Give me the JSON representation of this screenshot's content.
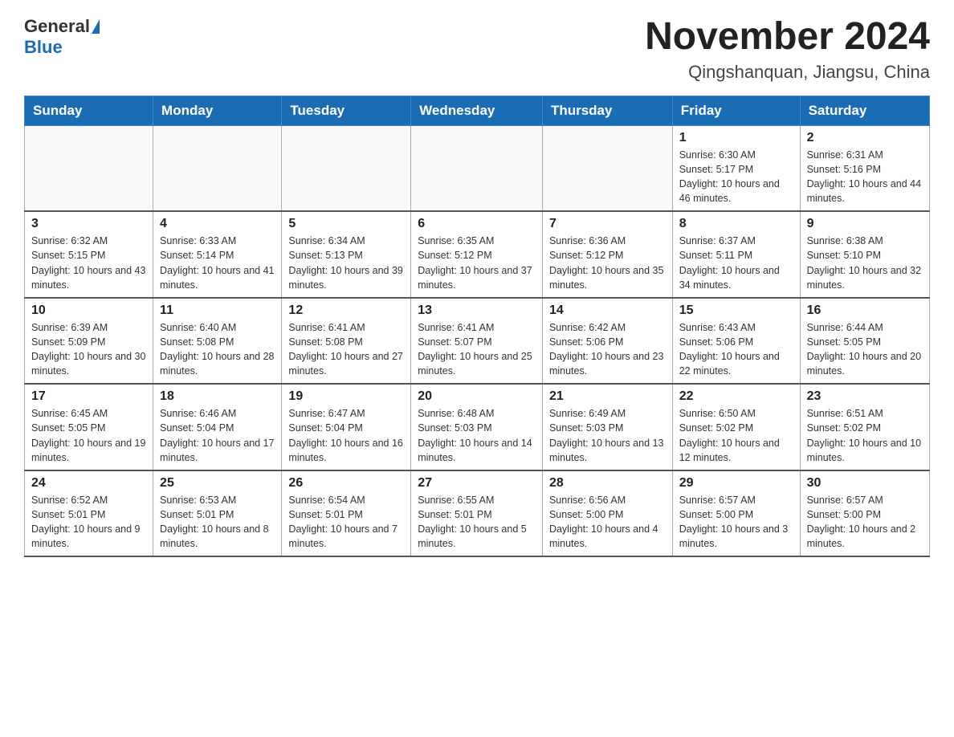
{
  "header": {
    "logo_general": "General",
    "logo_blue": "Blue",
    "title": "November 2024",
    "subtitle": "Qingshanquan, Jiangsu, China"
  },
  "days_of_week": [
    "Sunday",
    "Monday",
    "Tuesday",
    "Wednesday",
    "Thursday",
    "Friday",
    "Saturday"
  ],
  "weeks": [
    [
      {
        "day": "",
        "sunrise": "",
        "sunset": "",
        "daylight": "",
        "empty": true
      },
      {
        "day": "",
        "sunrise": "",
        "sunset": "",
        "daylight": "",
        "empty": true
      },
      {
        "day": "",
        "sunrise": "",
        "sunset": "",
        "daylight": "",
        "empty": true
      },
      {
        "day": "",
        "sunrise": "",
        "sunset": "",
        "daylight": "",
        "empty": true
      },
      {
        "day": "",
        "sunrise": "",
        "sunset": "",
        "daylight": "",
        "empty": true
      },
      {
        "day": "1",
        "sunrise": "Sunrise: 6:30 AM",
        "sunset": "Sunset: 5:17 PM",
        "daylight": "Daylight: 10 hours and 46 minutes.",
        "empty": false
      },
      {
        "day": "2",
        "sunrise": "Sunrise: 6:31 AM",
        "sunset": "Sunset: 5:16 PM",
        "daylight": "Daylight: 10 hours and 44 minutes.",
        "empty": false
      }
    ],
    [
      {
        "day": "3",
        "sunrise": "Sunrise: 6:32 AM",
        "sunset": "Sunset: 5:15 PM",
        "daylight": "Daylight: 10 hours and 43 minutes.",
        "empty": false
      },
      {
        "day": "4",
        "sunrise": "Sunrise: 6:33 AM",
        "sunset": "Sunset: 5:14 PM",
        "daylight": "Daylight: 10 hours and 41 minutes.",
        "empty": false
      },
      {
        "day": "5",
        "sunrise": "Sunrise: 6:34 AM",
        "sunset": "Sunset: 5:13 PM",
        "daylight": "Daylight: 10 hours and 39 minutes.",
        "empty": false
      },
      {
        "day": "6",
        "sunrise": "Sunrise: 6:35 AM",
        "sunset": "Sunset: 5:12 PM",
        "daylight": "Daylight: 10 hours and 37 minutes.",
        "empty": false
      },
      {
        "day": "7",
        "sunrise": "Sunrise: 6:36 AM",
        "sunset": "Sunset: 5:12 PM",
        "daylight": "Daylight: 10 hours and 35 minutes.",
        "empty": false
      },
      {
        "day": "8",
        "sunrise": "Sunrise: 6:37 AM",
        "sunset": "Sunset: 5:11 PM",
        "daylight": "Daylight: 10 hours and 34 minutes.",
        "empty": false
      },
      {
        "day": "9",
        "sunrise": "Sunrise: 6:38 AM",
        "sunset": "Sunset: 5:10 PM",
        "daylight": "Daylight: 10 hours and 32 minutes.",
        "empty": false
      }
    ],
    [
      {
        "day": "10",
        "sunrise": "Sunrise: 6:39 AM",
        "sunset": "Sunset: 5:09 PM",
        "daylight": "Daylight: 10 hours and 30 minutes.",
        "empty": false
      },
      {
        "day": "11",
        "sunrise": "Sunrise: 6:40 AM",
        "sunset": "Sunset: 5:08 PM",
        "daylight": "Daylight: 10 hours and 28 minutes.",
        "empty": false
      },
      {
        "day": "12",
        "sunrise": "Sunrise: 6:41 AM",
        "sunset": "Sunset: 5:08 PM",
        "daylight": "Daylight: 10 hours and 27 minutes.",
        "empty": false
      },
      {
        "day": "13",
        "sunrise": "Sunrise: 6:41 AM",
        "sunset": "Sunset: 5:07 PM",
        "daylight": "Daylight: 10 hours and 25 minutes.",
        "empty": false
      },
      {
        "day": "14",
        "sunrise": "Sunrise: 6:42 AM",
        "sunset": "Sunset: 5:06 PM",
        "daylight": "Daylight: 10 hours and 23 minutes.",
        "empty": false
      },
      {
        "day": "15",
        "sunrise": "Sunrise: 6:43 AM",
        "sunset": "Sunset: 5:06 PM",
        "daylight": "Daylight: 10 hours and 22 minutes.",
        "empty": false
      },
      {
        "day": "16",
        "sunrise": "Sunrise: 6:44 AM",
        "sunset": "Sunset: 5:05 PM",
        "daylight": "Daylight: 10 hours and 20 minutes.",
        "empty": false
      }
    ],
    [
      {
        "day": "17",
        "sunrise": "Sunrise: 6:45 AM",
        "sunset": "Sunset: 5:05 PM",
        "daylight": "Daylight: 10 hours and 19 minutes.",
        "empty": false
      },
      {
        "day": "18",
        "sunrise": "Sunrise: 6:46 AM",
        "sunset": "Sunset: 5:04 PM",
        "daylight": "Daylight: 10 hours and 17 minutes.",
        "empty": false
      },
      {
        "day": "19",
        "sunrise": "Sunrise: 6:47 AM",
        "sunset": "Sunset: 5:04 PM",
        "daylight": "Daylight: 10 hours and 16 minutes.",
        "empty": false
      },
      {
        "day": "20",
        "sunrise": "Sunrise: 6:48 AM",
        "sunset": "Sunset: 5:03 PM",
        "daylight": "Daylight: 10 hours and 14 minutes.",
        "empty": false
      },
      {
        "day": "21",
        "sunrise": "Sunrise: 6:49 AM",
        "sunset": "Sunset: 5:03 PM",
        "daylight": "Daylight: 10 hours and 13 minutes.",
        "empty": false
      },
      {
        "day": "22",
        "sunrise": "Sunrise: 6:50 AM",
        "sunset": "Sunset: 5:02 PM",
        "daylight": "Daylight: 10 hours and 12 minutes.",
        "empty": false
      },
      {
        "day": "23",
        "sunrise": "Sunrise: 6:51 AM",
        "sunset": "Sunset: 5:02 PM",
        "daylight": "Daylight: 10 hours and 10 minutes.",
        "empty": false
      }
    ],
    [
      {
        "day": "24",
        "sunrise": "Sunrise: 6:52 AM",
        "sunset": "Sunset: 5:01 PM",
        "daylight": "Daylight: 10 hours and 9 minutes.",
        "empty": false
      },
      {
        "day": "25",
        "sunrise": "Sunrise: 6:53 AM",
        "sunset": "Sunset: 5:01 PM",
        "daylight": "Daylight: 10 hours and 8 minutes.",
        "empty": false
      },
      {
        "day": "26",
        "sunrise": "Sunrise: 6:54 AM",
        "sunset": "Sunset: 5:01 PM",
        "daylight": "Daylight: 10 hours and 7 minutes.",
        "empty": false
      },
      {
        "day": "27",
        "sunrise": "Sunrise: 6:55 AM",
        "sunset": "Sunset: 5:01 PM",
        "daylight": "Daylight: 10 hours and 5 minutes.",
        "empty": false
      },
      {
        "day": "28",
        "sunrise": "Sunrise: 6:56 AM",
        "sunset": "Sunset: 5:00 PM",
        "daylight": "Daylight: 10 hours and 4 minutes.",
        "empty": false
      },
      {
        "day": "29",
        "sunrise": "Sunrise: 6:57 AM",
        "sunset": "Sunset: 5:00 PM",
        "daylight": "Daylight: 10 hours and 3 minutes.",
        "empty": false
      },
      {
        "day": "30",
        "sunrise": "Sunrise: 6:57 AM",
        "sunset": "Sunset: 5:00 PM",
        "daylight": "Daylight: 10 hours and 2 minutes.",
        "empty": false
      }
    ]
  ]
}
